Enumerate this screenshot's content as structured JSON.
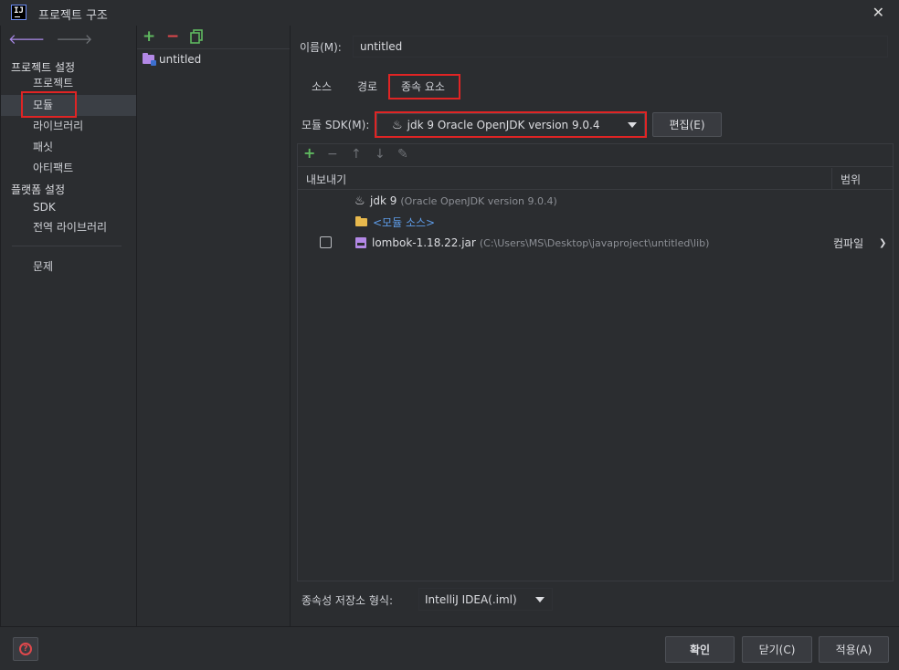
{
  "window": {
    "title": "프로젝트 구조",
    "logo_text": "IJ"
  },
  "sidebar": {
    "section_project": "프로젝트 설정",
    "project_items": [
      {
        "label": "프로젝트"
      },
      {
        "label": "모듈"
      },
      {
        "label": "라이브러리"
      },
      {
        "label": "패싯"
      },
      {
        "label": "아티팩트"
      }
    ],
    "section_platform": "플랫폼 설정",
    "platform_items": [
      {
        "label": "SDK"
      },
      {
        "label": "전역 라이브러리"
      }
    ],
    "problems": "문제",
    "selected": "모듈"
  },
  "modules": {
    "items": [
      {
        "name": "untitled"
      }
    ]
  },
  "main": {
    "name_label": "이름(M):",
    "name_value": "untitled",
    "tabs": [
      {
        "label": "소스"
      },
      {
        "label": "경로"
      },
      {
        "label": "종속 요소"
      }
    ],
    "active_tab": "종속 요소",
    "sdk_label": "모듈 SDK(M):",
    "sdk_value": "jdk 9  Oracle OpenJDK version 9.0.4",
    "edit_button": "편집(E)",
    "deps_header": {
      "export": "내보내기",
      "scope": "범위"
    },
    "deps": [
      {
        "name": "jdk 9",
        "detail": "(Oracle OpenJDK version 9.0.4)",
        "icon": "java-icon"
      },
      {
        "name": "<모듈 소스>",
        "icon": "folder-icon"
      },
      {
        "name": "lombok-1.18.22.jar",
        "detail": "(C:\\Users\\MS\\Desktop\\javaproject\\untitled\\lib)",
        "icon": "jar-icon",
        "exported": false,
        "scope": "컴파일"
      }
    ],
    "storage_label": "종속성 저장소 형식:",
    "storage_value": "IntelliJ IDEA(.iml)"
  },
  "footer": {
    "ok": "확인",
    "close": "닫기(C)",
    "apply": "적용(A)"
  },
  "colors": {
    "accent_red": "#e02424",
    "link_blue": "#5e9ce8",
    "add_green": "#5fb85f",
    "remove_red": "#e0484c"
  }
}
